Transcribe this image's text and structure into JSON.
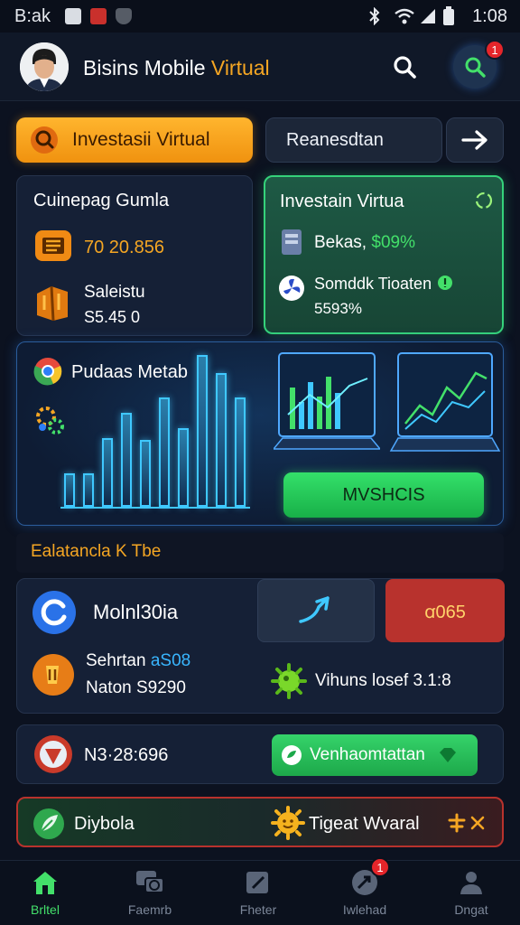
{
  "status_bar": {
    "carrier": "B:ak",
    "time": "1:08",
    "icons": [
      "photo-icon",
      "flipboard-icon",
      "shield-icon",
      "bluetooth-icon",
      "wifi-icon",
      "signal-icon",
      "battery-icon"
    ]
  },
  "header": {
    "title_prefix": "Bisins Mobile ",
    "title_accent": "Virtual",
    "notification_count": "1",
    "icons": [
      "avatar",
      "search-icon",
      "profile-search-icon"
    ]
  },
  "actions": {
    "primary_label": "Investasii Virtual",
    "secondary_label": "Reanesdtan",
    "arrow_icon": "arrow-right-icon"
  },
  "card_left": {
    "title": "Cuinepag Gumla",
    "row1_value": "70 20.856",
    "row2_label": "Saleistu",
    "row2_value": "S5.45 0"
  },
  "card_green": {
    "title": "Investain Virtua",
    "row1_label": "Bekas, ",
    "row1_value": "$09%",
    "row2_label": "Somddk Tioaten",
    "row2_value": "5593%"
  },
  "chart_panel": {
    "label": "Pudaas Metab",
    "bars": [
      0.22,
      0.22,
      0.45,
      0.62,
      0.44,
      0.72,
      0.52,
      1.0,
      0.88,
      0.72
    ],
    "button_label": "MVSHCIS"
  },
  "section": {
    "title": "Ealatancla K Tbe"
  },
  "card_mono": {
    "title": "Molnl30ia",
    "red_button": "ꭤ065"
  },
  "card_detail": {
    "line1_label": "Sehrtan ",
    "line1_value": "aS08",
    "line2": "Naton S9290",
    "right_label": "Vihuns losef 3.1:8"
  },
  "row_action": {
    "code": "N3·28:696",
    "button_label": "Venhaomtattan"
  },
  "row_bottom": {
    "left_label": "Diybola",
    "right_label": "Tigeat Wvaral"
  },
  "nav": {
    "items": [
      {
        "label": "Brltel",
        "icon": "home-icon",
        "active": true
      },
      {
        "label": "Faemrb",
        "icon": "chat-icon",
        "active": false
      },
      {
        "label": "Fheter",
        "icon": "edit-icon",
        "active": false
      },
      {
        "label": "Iwlehad",
        "icon": "rocket-icon",
        "active": false,
        "badge": "1"
      },
      {
        "label": "Dngat",
        "icon": "user-icon",
        "active": false
      }
    ]
  },
  "colors": {
    "background": "#0c1220",
    "accent_orange": "#f5a623",
    "accent_green": "#43e06a",
    "accent_blue": "#39b6ff",
    "danger_red": "#b8322d"
  }
}
